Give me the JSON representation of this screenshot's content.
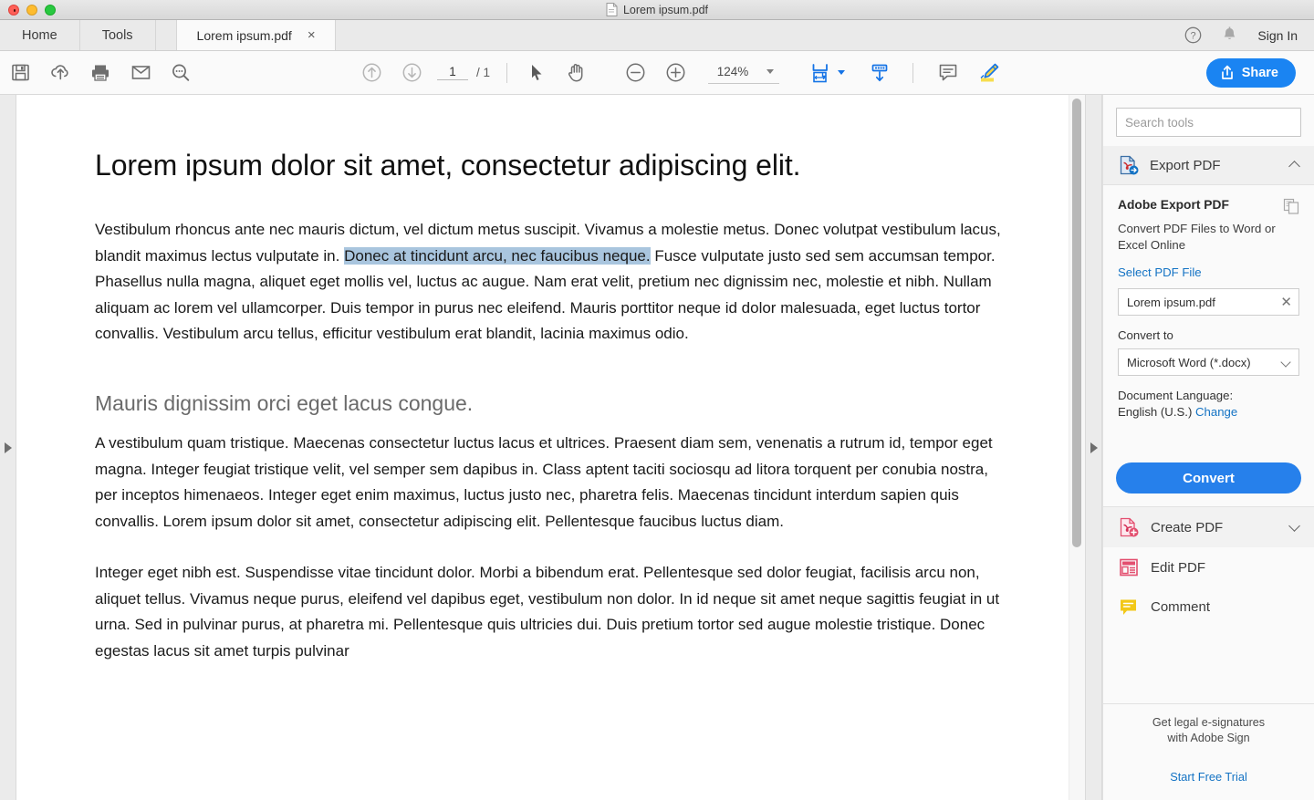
{
  "window": {
    "title": "Lorem ipsum.pdf",
    "doc_icon": "pdf-file-icon"
  },
  "tabbar": {
    "home_label": "Home",
    "tools_label": "Tools",
    "doc_tab_label": "Lorem ipsum.pdf",
    "close_label": "×",
    "help_icon": "help-circle-icon",
    "bell_icon": "notification-bell-icon",
    "signin_label": "Sign In"
  },
  "toolbar": {
    "save_icon": "save-floppy-icon",
    "upload_icon": "cloud-upload-icon",
    "print_icon": "print-icon",
    "email_icon": "email-envelope-icon",
    "search_icon": "search-magnifier-icon",
    "page_up_icon": "page-up-arrow-icon",
    "page_down_icon": "page-down-arrow-icon",
    "page_number": "1",
    "page_total": "/ 1",
    "select_tool_icon": "cursor-arrow-icon",
    "hand_tool_icon": "hand-pan-icon",
    "zoom_out_icon": "zoom-out-minus-icon",
    "zoom_in_icon": "zoom-in-plus-icon",
    "zoom_value": "124%",
    "fit_page_icon": "fit-page-width-icon",
    "scroll_mode_icon": "page-scroll-down-icon",
    "comment_icon": "comment-bubble-icon",
    "highlight_icon": "highlighter-pen-icon",
    "share_label": "Share",
    "share_icon": "share-upload-icon",
    "accent_blue": "#1a84f2"
  },
  "document": {
    "heading1": "Lorem ipsum dolor sit amet, consectetur adipiscing elit.",
    "paragraph1_pre": "Vestibulum rhoncus ante nec mauris dictum, vel dictum metus suscipit. Vivamus a molestie metus. Donec volutpat vestibulum lacus, blandit maximus lectus vulputate in. ",
    "paragraph1_selected": "Donec at tincidunt arcu, nec faucibus neque.",
    "paragraph1_post": " Fusce vulputate justo sed sem accumsan tempor. Phasellus nulla magna, aliquet eget mollis vel, luctus ac augue. Nam erat velit, pretium nec dignissim nec, molestie et nibh. Nullam aliquam ac lorem vel ullamcorper. Duis tempor in purus nec eleifend. Mauris porttitor neque id dolor malesuada, eget luctus tortor convallis. Vestibulum arcu tellus, efficitur vestibulum erat blandit, lacinia maximus odio.",
    "heading2": "Mauris dignissim orci eget lacus congue.",
    "paragraph2": "A vestibulum quam tristique. Maecenas consectetur luctus lacus et ultrices. Praesent diam sem, venenatis a rutrum id, tempor eget magna. Integer feugiat tristique velit, vel semper sem dapibus in. Class aptent taciti sociosqu ad litora torquent per conubia nostra, per inceptos himenaeos. Integer eget enim maximus, luctus justo nec, pharetra felis. Maecenas tincidunt interdum sapien quis convallis. Lorem ipsum dolor sit amet, consectetur adipiscing elit. Pellentesque faucibus luctus diam.",
    "paragraph3": "Integer eget nibh est. Suspendisse vitae tincidunt dolor. Morbi a bibendum erat. Pellentesque sed dolor feugiat, facilisis arcu non, aliquet tellus. Vivamus neque purus, eleifend vel dapibus eget, vestibulum non dolor. In id neque sit amet neque sagittis feugiat in ut urna. Sed in pulvinar purus, at pharetra mi. Pellentesque quis ultricies dui. Duis pretium tortor sed augue molestie tristique. Donec egestas lacus sit amet turpis pulvinar",
    "selection_color": "#a9c5de"
  },
  "rails": {
    "left_expand_icon": "expand-left-panel-triangle-icon",
    "right_expand_icon": "expand-right-panel-triangle-icon"
  },
  "sidebar": {
    "search_placeholder": "Search tools",
    "export_panel": {
      "icon": "export-pdf-icon",
      "label": "Export PDF",
      "collapse_icon": "chevron-up-icon",
      "title": "Adobe Export PDF",
      "copy_icon": "duplicate-pages-icon",
      "description": "Convert PDF Files to Word or Excel Online",
      "select_file_link": "Select PDF File",
      "selected_file": "Lorem ipsum.pdf",
      "clear_icon": "clear-x-icon",
      "convert_to_label": "Convert to",
      "convert_to_value": "Microsoft Word (*.docx)",
      "dropdown_icon": "chevron-down-icon",
      "language_label": "Document Language:",
      "language_value": "English (U.S.)",
      "change_link": "Change",
      "convert_button": "Convert"
    },
    "tools": [
      {
        "label": "Create PDF",
        "icon": "create-pdf-icon",
        "has_chevron": true
      },
      {
        "label": "Edit PDF",
        "icon": "edit-pdf-icon",
        "has_chevron": false
      },
      {
        "label": "Comment",
        "icon": "comment-tool-icon",
        "has_chevron": false
      }
    ],
    "promo": {
      "line1": "Get legal e-signatures",
      "line2": "with Adobe Sign",
      "link": "Start Free Trial"
    }
  }
}
